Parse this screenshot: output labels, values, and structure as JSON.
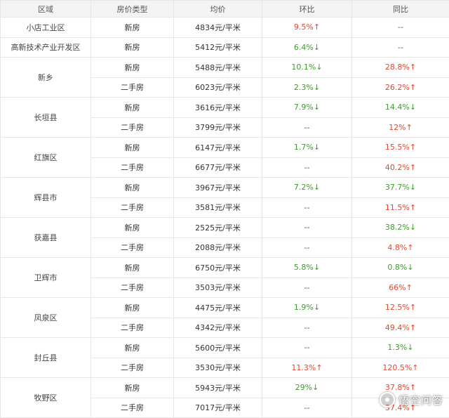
{
  "table": {
    "headers": [
      "区域",
      "房价类型",
      "均价",
      "环比",
      "同比"
    ],
    "colors": {
      "up": "#e8462d",
      "down": "#3c9d2a"
    },
    "regions": [
      {
        "name": "小店工业区",
        "rows": [
          {
            "type": "新房",
            "price": "4834元/平米",
            "mom": "9.5%↑",
            "mom_dir": "up",
            "yoy": "--",
            "yoy_dir": "none"
          }
        ]
      },
      {
        "name": "高新技术产业开发区",
        "rows": [
          {
            "type": "新房",
            "price": "5412元/平米",
            "mom": "6.4%↓",
            "mom_dir": "down",
            "yoy": "--",
            "yoy_dir": "none"
          }
        ]
      },
      {
        "name": "新乡",
        "rows": [
          {
            "type": "新房",
            "price": "5488元/平米",
            "mom": "10.1%↓",
            "mom_dir": "down",
            "yoy": "28.8%↑",
            "yoy_dir": "up"
          },
          {
            "type": "二手房",
            "price": "6023元/平米",
            "mom": "2.3%↓",
            "mom_dir": "down",
            "yoy": "26.2%↑",
            "yoy_dir": "up"
          }
        ]
      },
      {
        "name": "长垣县",
        "rows": [
          {
            "type": "新房",
            "price": "3616元/平米",
            "mom": "7.9%↓",
            "mom_dir": "down",
            "yoy": "14.4%↓",
            "yoy_dir": "down"
          },
          {
            "type": "二手房",
            "price": "3799元/平米",
            "mom": "--",
            "mom_dir": "none",
            "yoy": "12%↑",
            "yoy_dir": "up"
          }
        ]
      },
      {
        "name": "红旗区",
        "rows": [
          {
            "type": "新房",
            "price": "6147元/平米",
            "mom": "1.7%↓",
            "mom_dir": "down",
            "yoy": "15.5%↑",
            "yoy_dir": "up"
          },
          {
            "type": "二手房",
            "price": "6677元/平米",
            "mom": "--",
            "mom_dir": "none",
            "yoy": "40.2%↑",
            "yoy_dir": "up"
          }
        ]
      },
      {
        "name": "辉县市",
        "rows": [
          {
            "type": "新房",
            "price": "3967元/平米",
            "mom": "7.2%↓",
            "mom_dir": "down",
            "yoy": "37.7%↓",
            "yoy_dir": "down"
          },
          {
            "type": "二手房",
            "price": "3581元/平米",
            "mom": "--",
            "mom_dir": "none",
            "yoy": "11.5%↑",
            "yoy_dir": "up"
          }
        ]
      },
      {
        "name": "获嘉县",
        "rows": [
          {
            "type": "新房",
            "price": "2525元/平米",
            "mom": "--",
            "mom_dir": "none",
            "yoy": "38.2%↓",
            "yoy_dir": "down"
          },
          {
            "type": "二手房",
            "price": "2088元/平米",
            "mom": "--",
            "mom_dir": "none",
            "yoy": "4.8%↑",
            "yoy_dir": "up"
          }
        ]
      },
      {
        "name": "卫辉市",
        "rows": [
          {
            "type": "新房",
            "price": "6750元/平米",
            "mom": "5.8%↓",
            "mom_dir": "down",
            "yoy": "0.8%↓",
            "yoy_dir": "down"
          },
          {
            "type": "二手房",
            "price": "3503元/平米",
            "mom": "--",
            "mom_dir": "none",
            "yoy": "66%↑",
            "yoy_dir": "up"
          }
        ]
      },
      {
        "name": "凤泉区",
        "rows": [
          {
            "type": "新房",
            "price": "4475元/平米",
            "mom": "1.9%↓",
            "mom_dir": "down",
            "yoy": "12.5%↑",
            "yoy_dir": "up"
          },
          {
            "type": "二手房",
            "price": "4342元/平米",
            "mom": "--",
            "mom_dir": "none",
            "yoy": "49.4%↑",
            "yoy_dir": "up"
          }
        ]
      },
      {
        "name": "封丘县",
        "rows": [
          {
            "type": "新房",
            "price": "5600元/平米",
            "mom": "--",
            "mom_dir": "none",
            "yoy": "1.3%↓",
            "yoy_dir": "down"
          },
          {
            "type": "二手房",
            "price": "3530元/平米",
            "mom": "11.3%↑",
            "mom_dir": "up",
            "yoy": "120.5%↑",
            "yoy_dir": "up"
          }
        ]
      },
      {
        "name": "牧野区",
        "rows": [
          {
            "type": "新房",
            "price": "5943元/平米",
            "mom": "29%↓",
            "mom_dir": "down",
            "yoy": "37.8%↑",
            "yoy_dir": "up"
          },
          {
            "type": "二手房",
            "price": "7017元/平米",
            "mom": "--",
            "mom_dir": "none",
            "yoy": "37.4%↑",
            "yoy_dir": "up"
          }
        ]
      }
    ]
  },
  "watermark": {
    "text": "悟空问答",
    "icon": "wukong-logo-icon"
  }
}
